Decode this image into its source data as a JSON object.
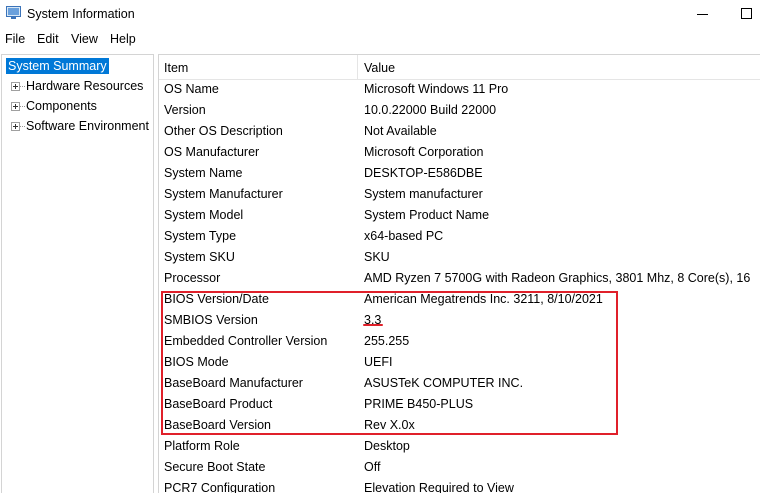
{
  "window": {
    "title": "System Information",
    "app_icon": "system-info-icon"
  },
  "menu": [
    "File",
    "Edit",
    "View",
    "Help"
  ],
  "tree": [
    {
      "label": "System Summary",
      "selected": true,
      "expandable": false
    },
    {
      "label": "Hardware Resources",
      "selected": false,
      "expandable": true
    },
    {
      "label": "Components",
      "selected": false,
      "expandable": true
    },
    {
      "label": "Software Environment",
      "selected": false,
      "expandable": true
    }
  ],
  "table": {
    "columns": [
      "Item",
      "Value"
    ],
    "rows": [
      {
        "item": "OS Name",
        "value": "Microsoft Windows 11 Pro"
      },
      {
        "item": "Version",
        "value": "10.0.22000 Build 22000"
      },
      {
        "item": "Other OS Description",
        "value": "Not Available"
      },
      {
        "item": "OS Manufacturer",
        "value": "Microsoft Corporation"
      },
      {
        "item": "System Name",
        "value": "DESKTOP-E586DBE"
      },
      {
        "item": "System Manufacturer",
        "value": "System manufacturer"
      },
      {
        "item": "System Model",
        "value": "System Product Name"
      },
      {
        "item": "System Type",
        "value": "x64-based PC"
      },
      {
        "item": "System SKU",
        "value": "SKU"
      },
      {
        "item": "Processor",
        "value": "AMD Ryzen 7 5700G with Radeon Graphics, 3801 Mhz, 8 Core(s), 16"
      },
      {
        "item": "BIOS Version/Date",
        "value": "American Megatrends Inc. 3211, 8/10/2021"
      },
      {
        "item": "SMBIOS Version",
        "value": "3.3"
      },
      {
        "item": "Embedded Controller Version",
        "value": "255.255"
      },
      {
        "item": "BIOS Mode",
        "value": "UEFI"
      },
      {
        "item": "BaseBoard Manufacturer",
        "value": "ASUSTeK COMPUTER INC."
      },
      {
        "item": "BaseBoard Product",
        "value": "PRIME B450-PLUS"
      },
      {
        "item": "BaseBoard Version",
        "value": "Rev X.0x"
      },
      {
        "item": "Platform Role",
        "value": "Desktop"
      },
      {
        "item": "Secure Boot State",
        "value": "Off"
      },
      {
        "item": "PCR7 Configuration",
        "value": "Elevation Required to View"
      }
    ]
  },
  "annotation": {
    "color": "#e0202a"
  }
}
